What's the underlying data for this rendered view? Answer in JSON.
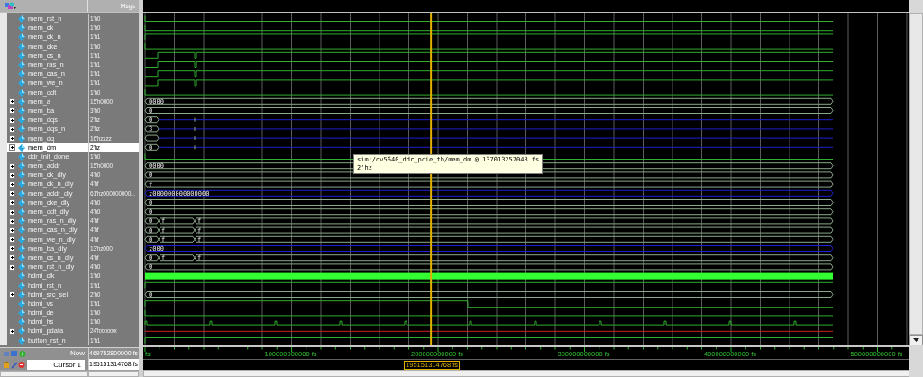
{
  "header": {
    "value_column": "Msgs"
  },
  "signals": [
    {
      "name": "mem_rst_n",
      "value": "1'h0",
      "expandable": false,
      "selected": false,
      "wave": {
        "kind": "low"
      }
    },
    {
      "name": "mem_ck",
      "value": "1'h0",
      "expandable": false,
      "selected": false,
      "wave": {
        "kind": "low"
      }
    },
    {
      "name": "mem_ck_n",
      "value": "1'h1",
      "expandable": false,
      "selected": false,
      "wave": {
        "kind": "high"
      }
    },
    {
      "name": "mem_cke",
      "value": "1'h0",
      "expandable": false,
      "selected": false,
      "wave": {
        "kind": "low"
      }
    },
    {
      "name": "mem_cs_n",
      "value": "1'h1",
      "expandable": false,
      "selected": false,
      "wave": {
        "kind": "step"
      }
    },
    {
      "name": "mem_ras_n",
      "value": "1'h1",
      "expandable": false,
      "selected": false,
      "wave": {
        "kind": "step"
      }
    },
    {
      "name": "mem_cas_n",
      "value": "1'h1",
      "expandable": false,
      "selected": false,
      "wave": {
        "kind": "step"
      }
    },
    {
      "name": "mem_we_n",
      "value": "1'h1",
      "expandable": false,
      "selected": false,
      "wave": {
        "kind": "step"
      }
    },
    {
      "name": "mem_odt",
      "value": "1'h0",
      "expandable": false,
      "selected": false,
      "wave": {
        "kind": "low"
      }
    },
    {
      "name": "mem_a",
      "value": "15'h0000",
      "expandable": true,
      "selected": false,
      "wave": {
        "kind": "bus",
        "labels": [
          "0000"
        ]
      }
    },
    {
      "name": "mem_ba",
      "value": "3'h0",
      "expandable": true,
      "selected": false,
      "wave": {
        "kind": "bus",
        "labels": [
          "0"
        ]
      }
    },
    {
      "name": "mem_dqs",
      "value": "2'hz",
      "expandable": true,
      "selected": false,
      "wave": {
        "kind": "zbus",
        "labels": [
          "0"
        ]
      }
    },
    {
      "name": "mem_dqs_n",
      "value": "2'hz",
      "expandable": true,
      "selected": false,
      "wave": {
        "kind": "zbus",
        "labels": [
          "3"
        ]
      }
    },
    {
      "name": "mem_dq",
      "value": "16'hzzzz",
      "expandable": true,
      "selected": false,
      "wave": {
        "kind": "zbus"
      }
    },
    {
      "name": "mem_dm",
      "value": "2'hz",
      "expandable": true,
      "selected": true,
      "wave": {
        "kind": "zbus",
        "labels": [
          "0"
        ]
      }
    },
    {
      "name": "ddr_init_done",
      "value": "1'h0",
      "expandable": false,
      "selected": false,
      "wave": {
        "kind": "low"
      }
    },
    {
      "name": "mem_addr",
      "value": "15'h0000",
      "expandable": true,
      "selected": false,
      "wave": {
        "kind": "bus",
        "labels": [
          "0000"
        ]
      }
    },
    {
      "name": "mem_ck_dly",
      "value": "4'h0",
      "expandable": true,
      "selected": false,
      "wave": {
        "kind": "bus",
        "labels": [
          "0"
        ]
      }
    },
    {
      "name": "mem_ck_n_dly",
      "value": "4'hf",
      "expandable": true,
      "selected": false,
      "wave": {
        "kind": "bus",
        "labels": [
          "f"
        ]
      }
    },
    {
      "name": "mem_addr_dly",
      "value": "61'hz000000000...",
      "expandable": true,
      "selected": false,
      "wave": {
        "kind": "zfull",
        "labels": [
          "z000000000000000"
        ]
      }
    },
    {
      "name": "mem_cke_dly",
      "value": "4'h0",
      "expandable": true,
      "selected": false,
      "wave": {
        "kind": "bus",
        "labels": [
          "0"
        ]
      }
    },
    {
      "name": "mem_odt_dly",
      "value": "4'h0",
      "expandable": true,
      "selected": false,
      "wave": {
        "kind": "bus",
        "labels": [
          "0"
        ]
      }
    },
    {
      "name": "mem_ras_n_dly",
      "value": "4'hf",
      "expandable": true,
      "selected": false,
      "wave": {
        "kind": "bus3",
        "labels": [
          "0",
          "f",
          "f"
        ]
      }
    },
    {
      "name": "mem_cas_n_dly",
      "value": "4'hf",
      "expandable": true,
      "selected": false,
      "wave": {
        "kind": "bus3",
        "labels": [
          "0",
          "f",
          "f"
        ]
      }
    },
    {
      "name": "mem_we_n_dly",
      "value": "4'hf",
      "expandable": true,
      "selected": false,
      "wave": {
        "kind": "bus3",
        "labels": [
          "0",
          "f",
          "f"
        ]
      }
    },
    {
      "name": "mem_ba_dly",
      "value": "13'hz000",
      "expandable": true,
      "selected": false,
      "wave": {
        "kind": "zfull",
        "labels": [
          "z000"
        ]
      }
    },
    {
      "name": "mem_cs_n_dly",
      "value": "4'hf",
      "expandable": true,
      "selected": false,
      "wave": {
        "kind": "bus3",
        "labels": [
          "0",
          "f",
          "f"
        ]
      }
    },
    {
      "name": "mem_rst_n_dly",
      "value": "4'h0",
      "expandable": true,
      "selected": false,
      "wave": {
        "kind": "bus",
        "labels": [
          "0"
        ]
      }
    },
    {
      "name": "hdmi_clk",
      "value": "1'h0",
      "expandable": false,
      "selected": false,
      "wave": {
        "kind": "clock"
      }
    },
    {
      "name": "hdmi_rst_n",
      "value": "1'h1",
      "expandable": false,
      "selected": false,
      "wave": {
        "kind": "high"
      }
    },
    {
      "name": "hdmi_src_sel",
      "value": "2'h0",
      "expandable": true,
      "selected": false,
      "wave": {
        "kind": "bus",
        "labels": [
          "0"
        ]
      }
    },
    {
      "name": "hdmi_vs",
      "value": "1'h1",
      "expandable": false,
      "selected": false,
      "wave": {
        "kind": "fall"
      }
    },
    {
      "name": "hdmi_de",
      "value": "1'h0",
      "expandable": false,
      "selected": false,
      "wave": {
        "kind": "low"
      }
    },
    {
      "name": "hdmi_hs",
      "value": "1'h0",
      "expandable": false,
      "selected": false,
      "wave": {
        "kind": "pulses"
      }
    },
    {
      "name": "hdmi_pdata",
      "value": "24'hxxxxxx",
      "expandable": true,
      "selected": false,
      "wave": {
        "kind": "unknown"
      }
    },
    {
      "name": "button_rst_n",
      "value": "1'h1",
      "expandable": false,
      "selected": false,
      "wave": {
        "kind": "high"
      }
    }
  ],
  "tooltip": {
    "lines": [
      "sim:/ov5640_ddr_pcie_tb/mem_dm @ 137013257048 fs",
      "2'hz"
    ]
  },
  "now": {
    "label": "Now",
    "value": "469752800000 fs"
  },
  "cursor": {
    "label": "Cursor 1",
    "value": "195151314768 fs",
    "marker": "195151314768 fs"
  },
  "timeline": {
    "labels": [
      "fs",
      "100000000000 fs",
      "200000000000 fs",
      "300000000000 fs",
      "400000000000 fs",
      "500000000000 fs"
    ]
  }
}
